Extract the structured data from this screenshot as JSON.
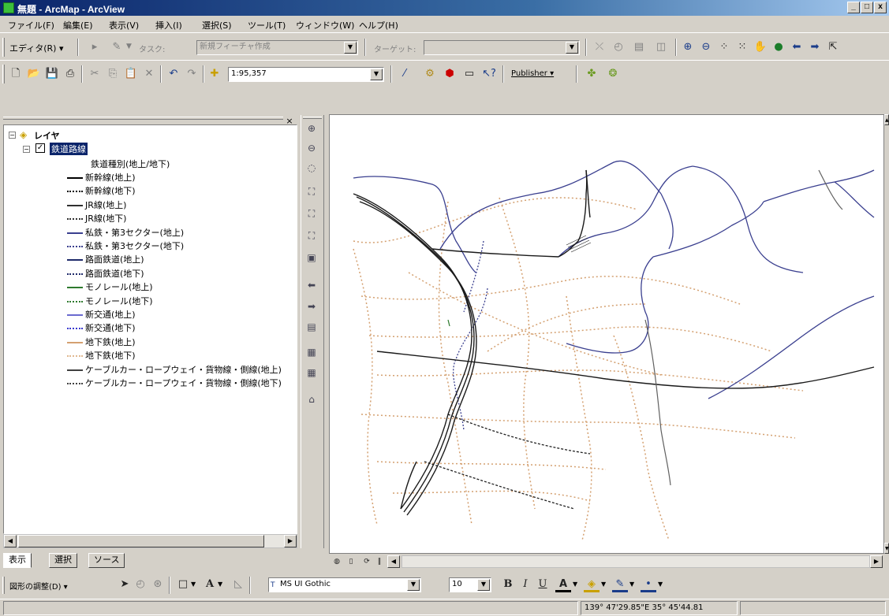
{
  "window": {
    "title": "無題 - ArcMap - ArcView",
    "buttons": [
      "_",
      "□",
      "x"
    ]
  },
  "menu": [
    {
      "label": "ファイル(F)"
    },
    {
      "label": "編集(E)"
    },
    {
      "label": "表示(V)"
    },
    {
      "label": "挿入(I)"
    },
    {
      "label": "選択(S)"
    },
    {
      "label": "ツール(T)"
    },
    {
      "label": "ウィンドウ(W)"
    },
    {
      "label": "ヘルプ(H)"
    }
  ],
  "editor_toolbar": {
    "editor_label": "エディタ(R) ▾",
    "task_label": "タスク:",
    "task_value": "新規フィーチャ作成",
    "target_label": "ターゲット:",
    "target_value": ""
  },
  "standard_toolbar": {
    "scale_value": "1:95,357",
    "publisher_label": "Publisher ▾"
  },
  "toc": {
    "root_label": "レイヤ",
    "layer_name": "鉄道路線",
    "field_label": "鉄道種別(地上/地下)",
    "legend": [
      {
        "label": "新幹線(地上)",
        "color": "#000000",
        "style": "solid"
      },
      {
        "label": "新幹線(地下)",
        "color": "#000000",
        "style": "dotted"
      },
      {
        "label": "JR線(地上)",
        "color": "#303030",
        "style": "solid"
      },
      {
        "label": "JR線(地下)",
        "color": "#303030",
        "style": "dotted"
      },
      {
        "label": "私鉄・第3セクター(地上)",
        "color": "#3a3f8f",
        "style": "solid"
      },
      {
        "label": "私鉄・第3セクター(地下)",
        "color": "#3a3f8f",
        "style": "dotted"
      },
      {
        "label": "路面鉄道(地上)",
        "color": "#1e2a6a",
        "style": "solid"
      },
      {
        "label": "路面鉄道(地下)",
        "color": "#1e2a6a",
        "style": "dotted"
      },
      {
        "label": "モノレール(地上)",
        "color": "#2e7a2e",
        "style": "solid"
      },
      {
        "label": "モノレール(地下)",
        "color": "#2e7a2e",
        "style": "dotted"
      },
      {
        "label": "新交通(地上)",
        "color": "#6a6acf",
        "style": "solid"
      },
      {
        "label": "新交通(地下)",
        "color": "#3a3acf",
        "style": "dotted"
      },
      {
        "label": "地下鉄(地上)",
        "color": "#d4a070",
        "style": "solid"
      },
      {
        "label": "地下鉄(地下)",
        "color": "#e0b890",
        "style": "dotted"
      },
      {
        "label": "ケーブルカー・ロープウェイ・貨物線・側線(地上)",
        "color": "#404040",
        "style": "solid"
      },
      {
        "label": "ケーブルカー・ロープウェイ・貨物線・側線(地下)",
        "color": "#404040",
        "style": "dotted"
      }
    ],
    "tabs": [
      "表示",
      "選択",
      "ソース"
    ]
  },
  "draw_toolbar": {
    "drawing_label": "図形の調整(D) ▾",
    "font_name": "MS UI Gothic",
    "font_size": "10",
    "bold": "B",
    "italic": "I",
    "underline": "U"
  },
  "status": {
    "coordinates": "139° 47'29.85\"E  35° 45'44.81"
  },
  "colors": {
    "ground_line": "#000000",
    "private_line": "#3a3f8f",
    "subway": "#d4a070"
  }
}
